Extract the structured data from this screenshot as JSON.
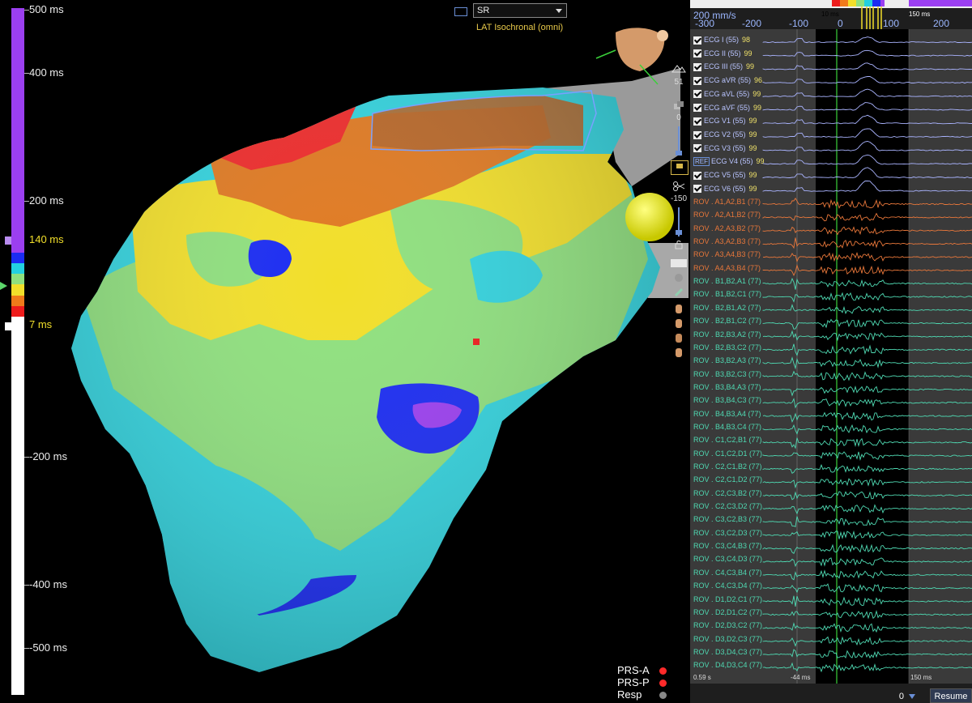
{
  "colors": {
    "purple": "#9b3ff0",
    "blue": "#1b2cf2",
    "cyan": "#23d0e0",
    "green": "#8fe07e",
    "yellow": "#f2df2a",
    "orange": "#f07a1a",
    "red": "#ee1c1c",
    "white": "#ffffff"
  },
  "scale": {
    "labels": [
      "500 ms",
      "400 ms",
      "200 ms",
      "140 ms",
      "7 ms",
      "-200 ms",
      "-400 ms",
      "-500 ms"
    ],
    "highlight_top": "140 ms",
    "highlight_bottom": "7 ms"
  },
  "map": {
    "rhythm": "SR",
    "map_type": "LAT Isochronal (omni)"
  },
  "toolbar": {
    "value_a": "51",
    "value_b": "0",
    "value_c": "-150"
  },
  "legend": [
    {
      "label": "PRS-A",
      "color": "#ff2a2a"
    },
    {
      "label": "PRS-P",
      "color": "#ff2a2a"
    },
    {
      "label": "Resp",
      "color": "#888888"
    }
  ],
  "panel": {
    "speed": "200 mm/s",
    "axis_ticks": [
      "-300",
      "-200",
      "-100",
      "0",
      "100",
      "200"
    ],
    "window_left": "10 ms",
    "window_right": "150 ms",
    "ecg": [
      {
        "label": "ECG I (55)",
        "val": "98"
      },
      {
        "label": "ECG II (55)",
        "val": "99"
      },
      {
        "label": "ECG III (55)",
        "val": "99"
      },
      {
        "label": "ECG aVR (55)",
        "val": "96"
      },
      {
        "label": "ECG aVL (55)",
        "val": "99"
      },
      {
        "label": "ECG aVF (55)",
        "val": "99"
      },
      {
        "label": "ECG V1 (55)",
        "val": "99"
      },
      {
        "label": "ECG V2 (55)",
        "val": "99"
      },
      {
        "label": "ECG V3 (55)",
        "val": "99"
      },
      {
        "label": "ECG V4 (55)",
        "val": "99",
        "ref": "REF"
      },
      {
        "label": "ECG V5 (55)",
        "val": "99"
      },
      {
        "label": "ECG V6 (55)",
        "val": "99"
      }
    ],
    "rov_orange": [
      "ROV . A1,A2,B1 (77)",
      "ROV . A2,A1,B2 (77)",
      "ROV . A2,A3,B2 (77)",
      "ROV . A3,A2,B3 (77)",
      "ROV . A3,A4,B3 (77)",
      "ROV . A4,A3,B4 (77)"
    ],
    "rov_green": [
      "ROV . B1,B2,A1 (77)",
      "ROV . B1,B2,C1 (77)",
      "ROV . B2,B1,A2 (77)",
      "ROV . B2,B1,C2 (77)",
      "ROV . B2,B3,A2 (77)",
      "ROV . B2,B3,C2 (77)",
      "ROV . B3,B2,A3 (77)",
      "ROV . B3,B2,C3 (77)",
      "ROV . B3,B4,A3 (77)",
      "ROV . B3,B4,C3 (77)",
      "ROV . B4,B3,A4 (77)",
      "ROV . B4,B3,C4 (77)",
      "ROV . C1,C2,B1 (77)",
      "ROV . C1,C2,D1 (77)",
      "ROV . C2,C1,B2 (77)",
      "ROV . C2,C1,D2 (77)",
      "ROV . C2,C3,B2 (77)",
      "ROV . C2,C3,D2 (77)",
      "ROV . C3,C2,B3 (77)",
      "ROV . C3,C2,D3 (77)",
      "ROV . C3,C4,B3 (77)",
      "ROV . C3,C4,D3 (77)",
      "ROV . C4,C3,B4 (77)",
      "ROV . C4,C3,D4 (77)",
      "ROV . D1,D2,C1 (77)",
      "ROV . D2,D1,C2 (77)",
      "ROV . D2,D3,C2 (77)",
      "ROV . D3,D2,C3 (77)",
      "ROV . D3,D4,C3 (77)",
      "ROV . D4,D3,C4 (77)"
    ],
    "bottom_left": "0.59 s",
    "bottom_mid": "-44 ms",
    "bottom_right": "150 ms",
    "offset_value": "0",
    "resume": "Resume"
  }
}
